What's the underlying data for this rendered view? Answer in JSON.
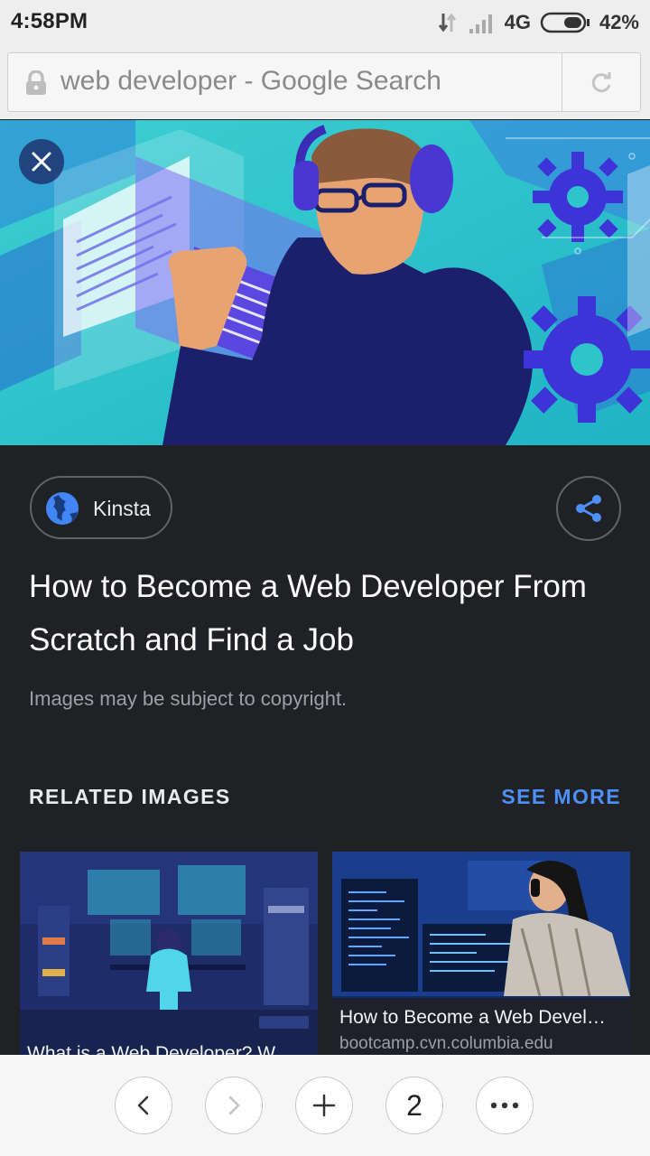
{
  "status": {
    "time": "4:58PM",
    "network": "4G",
    "battery": "42%"
  },
  "address": {
    "url_text": "web developer - Google Search"
  },
  "result": {
    "source": "Kinsta",
    "title": "How to Become a Web Developer From Scratch and Find a Job",
    "copyright": "Images may be subject to copyright."
  },
  "related": {
    "heading": "RELATED IMAGES",
    "see_more": "SEE MORE",
    "items": [
      {
        "title": "What is a Web Developer? W",
        "source": ""
      },
      {
        "title": "How to Become a Web Devel…",
        "source": "bootcamp.cvn.columbia.edu"
      }
    ]
  },
  "toolbar": {
    "tab_count": "2"
  },
  "colors": {
    "panel_bg": "#202124",
    "accent": "#4d8ff7",
    "hero_teal": "#2ec4c9"
  },
  "icons": [
    "lock-icon",
    "reload-icon",
    "close-icon",
    "globe-icon",
    "share-icon",
    "back-icon",
    "forward-icon",
    "new-tab-icon",
    "more-icon"
  ]
}
